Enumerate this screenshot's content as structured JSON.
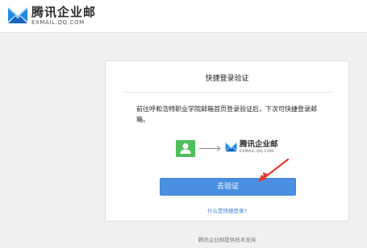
{
  "header": {
    "logo_cn": "腾讯企业邮",
    "logo_en": "EXMAIL.QQ.COM"
  },
  "card": {
    "title": "快捷登录验证",
    "description": "前往呼和浩特职业学院邮箱首页登录验证后，下次可快捷登录邮箱。",
    "flow": {
      "avatar_icon": "user-icon",
      "arrow_icon": "arrow-right-icon",
      "brand_cn": "腾讯企业邮",
      "brand_en": "EXMAIL.QQ.COM"
    },
    "verify_button": "去验证",
    "help_link": "什么是快捷登录?"
  },
  "footer": {
    "text": "腾讯企业邮提供技术支持"
  },
  "colors": {
    "background": "#f0f0f0",
    "primary_button": "#4a90e2",
    "avatar_green": "#4fbf5b",
    "link_blue": "#3b7dd8",
    "annotation_red": "#e53935"
  }
}
